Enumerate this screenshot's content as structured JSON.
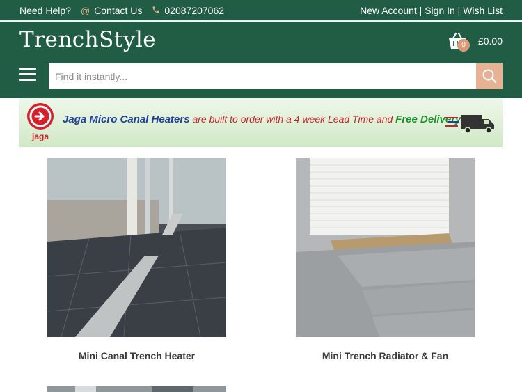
{
  "topbar": {
    "help": "Need Help?",
    "contact": "Contact Us",
    "phone": "02087207062",
    "account_links": "New Account | Sign In | Wish List"
  },
  "header": {
    "logo": "TrenchStyle",
    "cart_count": "0",
    "cart_total": "£0.00"
  },
  "search": {
    "placeholder": "Find it instantly..."
  },
  "banner": {
    "logo_text": "jaga",
    "brand": "Jaga Micro Canal Heaters",
    "middle": " are built to order with a 4 week Lead Time and ",
    "free": "Free Delivery."
  },
  "products": [
    {
      "title": "Mini Canal Trench Heater"
    },
    {
      "title": "Mini Trench Radiator & Fan"
    }
  ],
  "colors": {
    "brand_green": "#215c45",
    "accent_peach": "#e7b194"
  }
}
